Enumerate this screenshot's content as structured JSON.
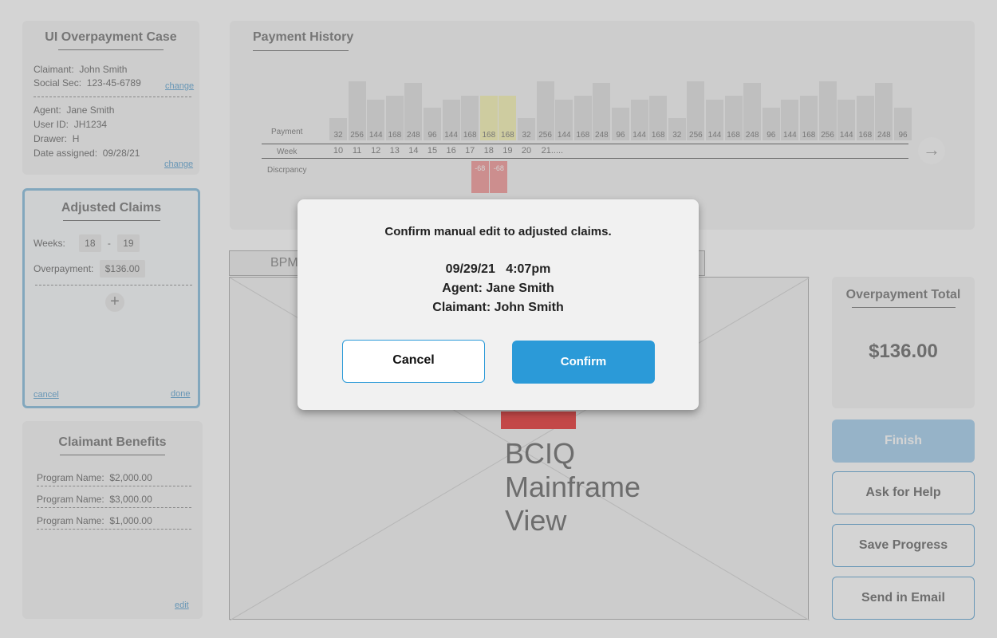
{
  "case": {
    "title": "UI Overpayment Case",
    "claimant_label": "Claimant:",
    "claimant_value": "John Smith",
    "ssn_label": "Social Sec:",
    "ssn_value": "123-45-6789",
    "change1": "change",
    "agent_label": "Agent:",
    "agent_value": "Jane Smith",
    "userid_label": "User ID:",
    "userid_value": "JH1234",
    "drawer_label": "Drawer:",
    "drawer_value": "H",
    "date_label": "Date assigned:",
    "date_value": "09/28/21",
    "change2": "change"
  },
  "adjusted": {
    "title": "Adjusted Claims",
    "weeks_label": "Weeks:",
    "week_from": "18",
    "dash": "-",
    "week_to": "19",
    "overpayment_label": "Overpayment:",
    "overpayment_value": "$136.00",
    "plus": "+",
    "cancel": "cancel",
    "done": "done"
  },
  "benefits": {
    "title": "Claimant Benefits",
    "rows": [
      {
        "label": "Program Name:",
        "value": "$2,000.00"
      },
      {
        "label": "Program Name:",
        "value": "$3,000.00"
      },
      {
        "label": "Program Name:",
        "value": "$1,000.00"
      }
    ],
    "edit": "edit"
  },
  "history": {
    "title": "Payment History",
    "payment_label": "Payment",
    "week_label": "Week",
    "discrepancy_label": "Discrpancy",
    "payments": [
      32,
      256,
      144,
      168,
      248,
      96,
      144,
      168,
      168,
      168,
      32,
      256,
      144,
      168,
      248,
      96,
      144,
      168,
      32,
      256,
      144,
      168,
      248,
      96,
      144,
      168,
      256,
      144,
      168,
      248,
      96
    ],
    "highlighted_indices": [
      8,
      9
    ],
    "weeks": [
      "10",
      "11",
      "12",
      "13",
      "14",
      "15",
      "16",
      "17",
      "18",
      "19",
      "20",
      "21....."
    ],
    "discrepancies": [
      "-68",
      "-68"
    ],
    "discrepancy_indices": [
      8,
      9
    ],
    "next_icon": "arrow-right-icon"
  },
  "main": {
    "tab_label": "BPM",
    "mainframe_text": "BCIQ\nMainframe\nView"
  },
  "total": {
    "title": "Overpayment Total",
    "value": "$136.00"
  },
  "buttons": {
    "finish": "Finish",
    "help": "Ask for Help",
    "save": "Save Progress",
    "email": "Send in Email"
  },
  "modal": {
    "title": "Confirm manual edit to adjusted claims.",
    "datetime": "09/29/21   4:07pm",
    "agent": "Agent: Jane Smith",
    "claimant": "Claimant: John Smith",
    "cancel": "Cancel",
    "confirm": "Confirm"
  },
  "colors": {
    "accent": "#2b9ad8",
    "highlight": "#f5f0a0",
    "discrepancy": "#f08080"
  }
}
